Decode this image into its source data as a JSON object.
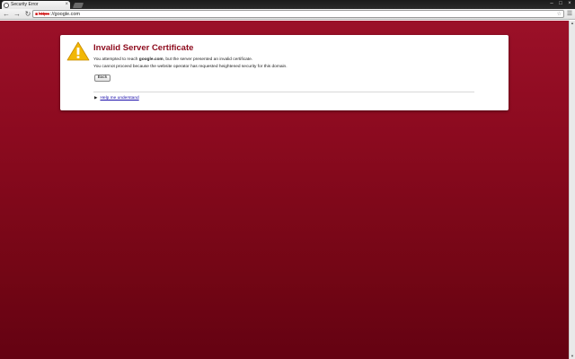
{
  "tab": {
    "title": "Security Error",
    "favicon": "globe-icon",
    "close_glyph": "×"
  },
  "window_controls": {
    "minimize": "–",
    "maximize": "□",
    "close": "×"
  },
  "toolbar": {
    "back_glyph": "←",
    "forward_glyph": "→",
    "reload_glyph": "↻",
    "url_scheme": "https",
    "url_rest": "://google.com",
    "star_glyph": "☆",
    "wrench_glyph": "🔧"
  },
  "interstitial": {
    "title": "Invalid Server Certificate",
    "line1_prefix": "You attempted to reach ",
    "line1_host": "google.com",
    "line1_suffix": ", but the server presented an invalid certificate.",
    "line2": "You cannot proceed because the website operator has requested heightened security for this domain.",
    "back_button": "Back",
    "help_link": "Help me understand",
    "help_toggle_glyph": "▶"
  },
  "colors": {
    "background_top": "#9b1028",
    "background_bottom": "#640212",
    "title": "#8d0a1c",
    "warning_icon": "#f2b705"
  }
}
